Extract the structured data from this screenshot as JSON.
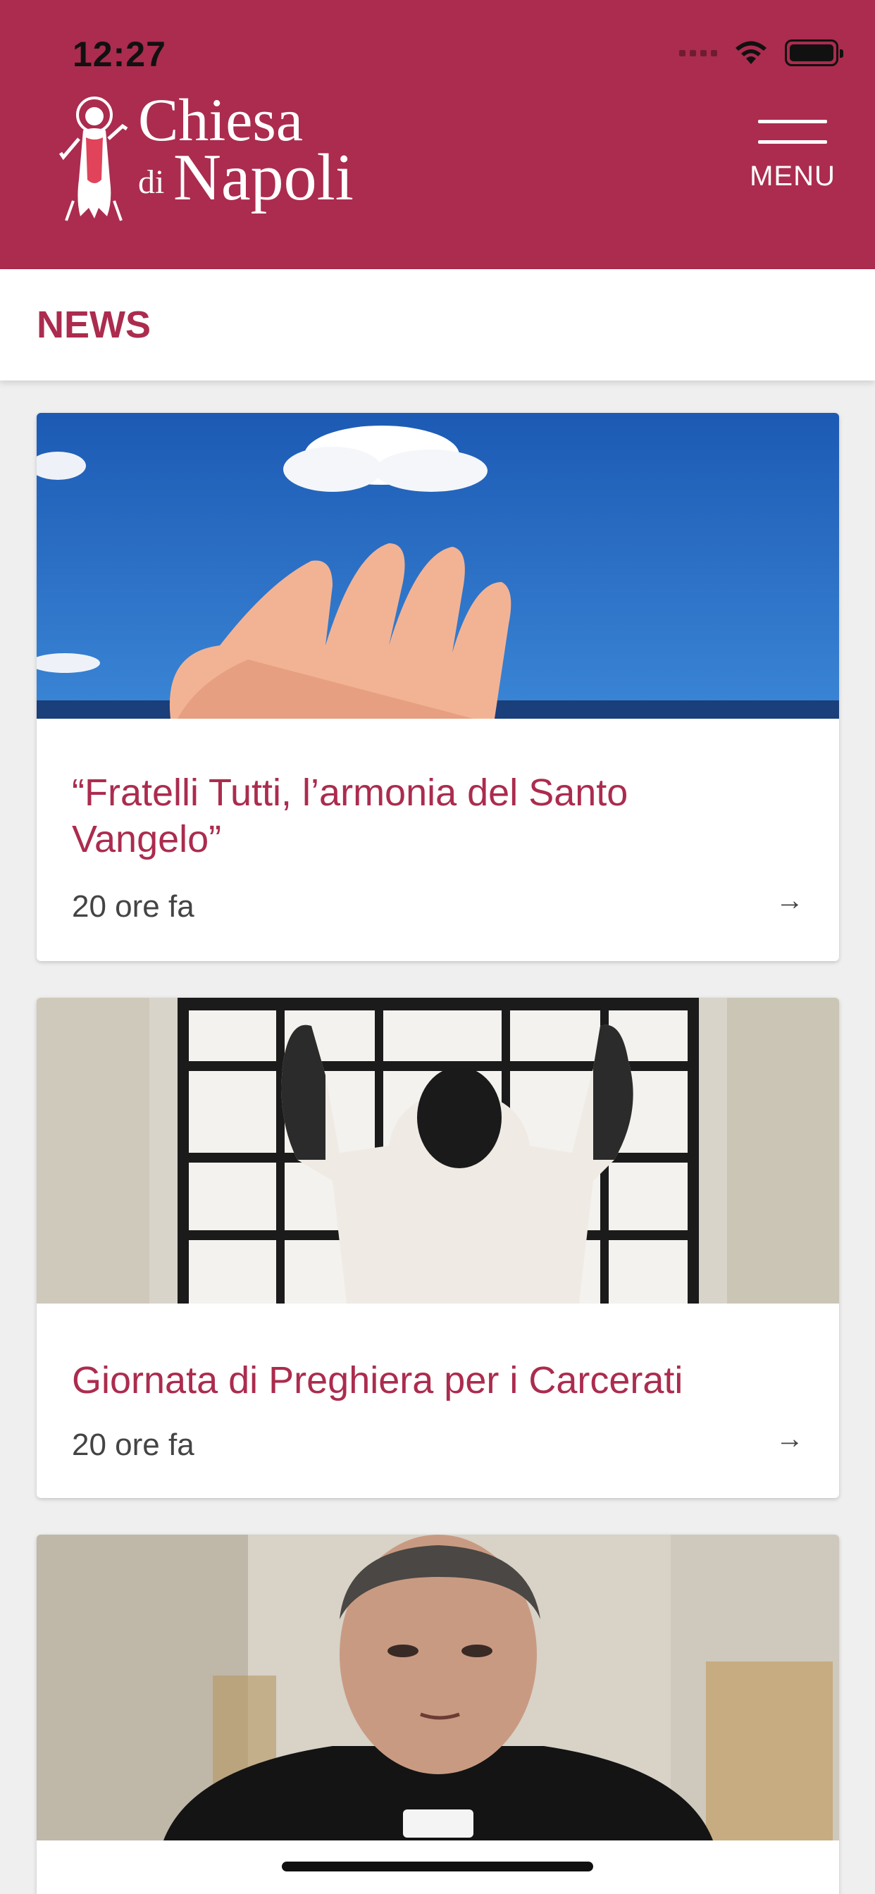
{
  "status_bar": {
    "time": "12:27"
  },
  "header": {
    "logo_line1": "Chiesa",
    "logo_di": "di",
    "logo_line2": "Napoli",
    "menu_label": "MENU",
    "colors": {
      "brand": "#ab2c4e",
      "text_on_brand": "#ffffff"
    }
  },
  "section": {
    "title": "NEWS"
  },
  "articles": [
    {
      "title": "“Fratelli Tutti, l’armonia del Santo Vangelo”",
      "time": "20 ore fa",
      "image": "hand-reaching-sky"
    },
    {
      "title": "Giornata di Preghiera per i Carcerati",
      "time": "20 ore fa",
      "image": "prisoner-at-window"
    },
    {
      "title": "",
      "time": "",
      "image": "priest-portrait"
    }
  ],
  "icons": {
    "arrow": "→",
    "menu": "hamburger-icon"
  }
}
